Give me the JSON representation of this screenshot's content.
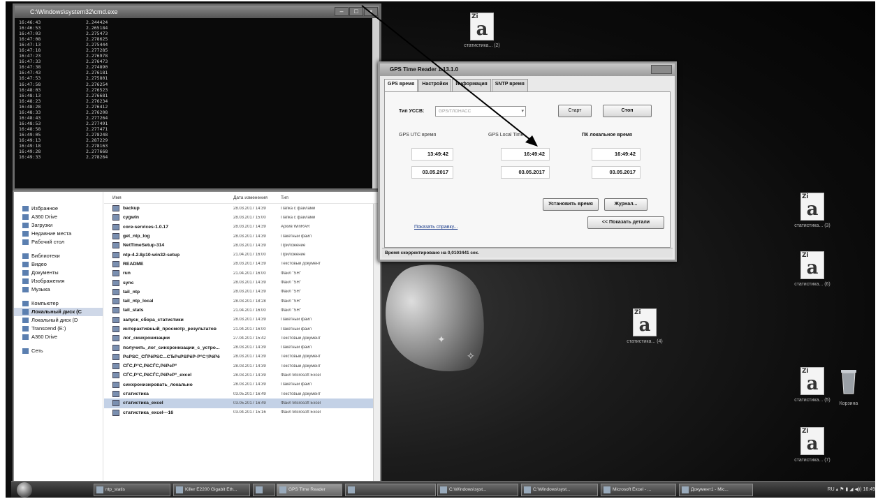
{
  "desktop": {
    "icons": [
      {
        "name": "desk-icon-1",
        "label": "статистика... (2)"
      },
      {
        "name": "desk-icon-2",
        "label": "статистика... (3)"
      },
      {
        "name": "desk-icon-3",
        "label": "статистика... (6)"
      },
      {
        "name": "desk-icon-4",
        "label": "статистика... (4)"
      },
      {
        "name": "desk-icon-5",
        "label": "статистика... (5)"
      },
      {
        "name": "desk-icon-6",
        "label": "статистика... (7)"
      },
      {
        "name": "recycle-bin",
        "label": "Корзина"
      }
    ]
  },
  "console": {
    "title": "C:\\Windows\\system32\\cmd.exe",
    "lines": [
      {
        "time": "16:46:43",
        "value": "2.244424"
      },
      {
        "time": "16:46:53",
        "value": "2.265184"
      },
      {
        "time": "16:47:03",
        "value": "2.275473"
      },
      {
        "time": "16:47:08",
        "value": "2.278625"
      },
      {
        "time": "16:47:13",
        "value": "2.275444"
      },
      {
        "time": "16:47:18",
        "value": "2.277285"
      },
      {
        "time": "16:47:23",
        "value": "2.276978"
      },
      {
        "time": "16:47:33",
        "value": "2.276473"
      },
      {
        "time": "16:47:38",
        "value": "2.274890"
      },
      {
        "time": "16:47:43",
        "value": "2.276181"
      },
      {
        "time": "16:47:53",
        "value": "2.275801"
      },
      {
        "time": "16:47:58",
        "value": "2.276254"
      },
      {
        "time": "16:48:03",
        "value": "2.276523"
      },
      {
        "time": "16:48:13",
        "value": "2.276681"
      },
      {
        "time": "16:48:23",
        "value": "2.276234"
      },
      {
        "time": "16:48:28",
        "value": "2.276412"
      },
      {
        "time": "16:48:33",
        "value": "2.276208"
      },
      {
        "time": "16:48:43",
        "value": "2.277264"
      },
      {
        "time": "16:48:53",
        "value": "2.277491"
      },
      {
        "time": "16:48:58",
        "value": "2.277471"
      },
      {
        "time": "16:49:05",
        "value": "2.278248"
      },
      {
        "time": "16:49:13",
        "value": "2.287229"
      },
      {
        "time": "16:49:18",
        "value": "2.278163"
      },
      {
        "time": "16:49:28",
        "value": "2.277668"
      },
      {
        "time": "16:49:33",
        "value": "2.278264"
      }
    ]
  },
  "explorer": {
    "nav": [
      {
        "label": "Избранное",
        "bold": false,
        "gap": false
      },
      {
        "label": "A360 Drive",
        "bold": false,
        "gap": false
      },
      {
        "label": "Загрузки",
        "bold": false,
        "gap": false
      },
      {
        "label": "Недавние места",
        "bold": false,
        "gap": false
      },
      {
        "label": "Рабочий стол",
        "bold": false,
        "gap": false
      },
      {
        "label": "Библиотеки",
        "bold": false,
        "gap": true
      },
      {
        "label": "Видео",
        "bold": false,
        "gap": false
      },
      {
        "label": "Документы",
        "bold": false,
        "gap": false
      },
      {
        "label": "Изображения",
        "bold": false,
        "gap": false
      },
      {
        "label": "Музыка",
        "bold": false,
        "gap": false
      },
      {
        "label": "Компьютер",
        "bold": false,
        "gap": true
      },
      {
        "label": "Локальный диск (C",
        "bold": true,
        "gap": false,
        "selected": true
      },
      {
        "label": "Локальный диск (D",
        "bold": false,
        "gap": false
      },
      {
        "label": "Transcend (E:)",
        "bold": false,
        "gap": false
      },
      {
        "label": "A360 Drive",
        "bold": false,
        "gap": false
      },
      {
        "label": "Сеть",
        "bold": false,
        "gap": true
      }
    ],
    "headers": {
      "name": "Имя",
      "date": "Дата изменения",
      "type": "Тип"
    },
    "files": [
      {
        "name": "backup",
        "date": "28.03.2017 14:39",
        "type": "Папка с файлами"
      },
      {
        "name": "cygwin",
        "date": "28.03.2017 15:00",
        "type": "Папка с файлами"
      },
      {
        "name": "core-services-1.0.17",
        "date": "28.03.2017 14:39",
        "type": "Архив WinRAR"
      },
      {
        "name": "get_ntp_log",
        "date": "28.03.2017 14:39",
        "type": "Пакетный файл"
      },
      {
        "name": "NetTimeSetup-314",
        "date": "28.03.2017 14:39",
        "type": "Приложение"
      },
      {
        "name": "ntp-4.2.8p10-win32-setup",
        "date": "21.04.2017 16:00",
        "type": "Приложение"
      },
      {
        "name": "README",
        "date": "28.03.2017 14:39",
        "type": "Текстовый документ"
      },
      {
        "name": "run",
        "date": "21.04.2017 16:00",
        "type": "Файл \"SH\""
      },
      {
        "name": "sync",
        "date": "28.03.2017 14:39",
        "type": "Файл \"SH\""
      },
      {
        "name": "tail_ntp",
        "date": "28.03.2017 14:39",
        "type": "Файл \"SH\""
      },
      {
        "name": "tail_ntp_local",
        "date": "28.03.2017 18:28",
        "type": "Файл \"SH\""
      },
      {
        "name": "tail_stats",
        "date": "21.04.2017 16:00",
        "type": "Файл \"SH\""
      },
      {
        "name": "запуск_сбора_статистики",
        "date": "28.03.2017 14:39",
        "type": "Пакетный файл"
      },
      {
        "name": "интерактивный_просмотр_результатов",
        "date": "21.04.2017 16:00",
        "type": "Пакетный файл"
      },
      {
        "name": "лог_синхронизации",
        "date": "27.04.2017 15:42",
        "type": "Текстовый документ"
      },
      {
        "name": "получить_лог_синхронизации_с_устро...",
        "date": "28.03.2017 14:39",
        "type": "Пакетный файл"
      },
      {
        "name": "РѕРЅС_СЃРёРЅС...СЂРѕРЅРёР·Р°С†РёРё",
        "date": "28.03.2017 14:39",
        "type": "Текстовый документ"
      },
      {
        "name": "СЃС‚Р°С‚РёСЃС‚РёРєР°",
        "date": "28.03.2017 14:39",
        "type": "Текстовый документ"
      },
      {
        "name": "СЃС‚Р°С‚РёСЃС‚РёРєР°_excel",
        "date": "28.03.2017 14:39",
        "type": "Файл Microsoft Excel"
      },
      {
        "name": "синхронизировать_локально",
        "date": "28.03.2017 14:39",
        "type": "Пакетный файл"
      },
      {
        "name": "статистика",
        "date": "03.05.2017 16:49",
        "type": "Текстовый документ"
      },
      {
        "name": "статистика_excel",
        "date": "03.05.2017 16:49",
        "type": "Файл Microsoft Excel",
        "selected": true
      },
      {
        "name": "статистика_excel---16",
        "date": "03.04.2017 15:16",
        "type": "Файл Microsoft Excel"
      }
    ]
  },
  "gps": {
    "title": "GPS Time Reader 1.13.1.0",
    "tabs": [
      "GPS время",
      "Настройки",
      "Информация",
      "SNTP время"
    ],
    "type_label": "Тип УССВ:",
    "type_value": "GPS/ГЛОНАСС",
    "start_label": "Старт",
    "stop_label": "Стоп",
    "col_utc": "GPS UTC время",
    "col_local": "GPS Local Time",
    "col_pc": "ПК локальное время",
    "utc_time": "13:49:42",
    "local_time": "16:49:42",
    "pc_time": "16:49:42",
    "utc_date": "03.05.2017",
    "local_date": "03.05.2017",
    "pc_date": "03.05.2017",
    "set_time_label": "Установить время",
    "journal_label": "Журнал...",
    "show_details_label": "<< Показать детали",
    "help_link": "Показать справку...",
    "status": "Время скорректировано на 0,0103441 сек."
  },
  "taskbar": {
    "items": [
      "ntp_statis",
      "Killer E2200 Gigabit Eth...",
      "",
      "GPS Time Reader",
      "",
      "C:\\Windows\\syst...",
      "C:\\Windows\\syst...",
      "Microsoft Excel - ...",
      "Документ1 - Mic..."
    ],
    "tray": "RU",
    "clock": "16:49"
  }
}
